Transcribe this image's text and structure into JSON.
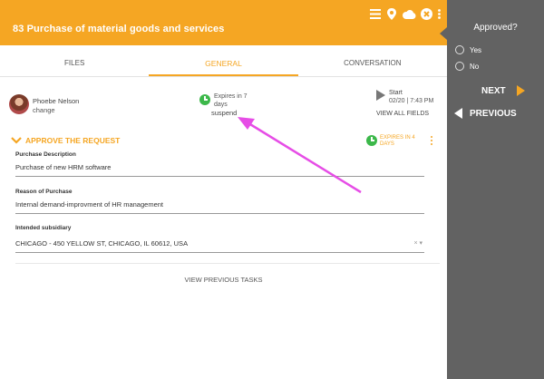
{
  "header": {
    "title": "83 Purchase of material goods and services",
    "icons": [
      "menu-icon",
      "location-icon",
      "cloud-icon",
      "close-icon",
      "more-icon"
    ]
  },
  "tabs": [
    {
      "label": "FILES"
    },
    {
      "label": "GENERAL",
      "active": true
    },
    {
      "label": "CONVERSATION"
    }
  ],
  "user": {
    "name": "Phoebe Nelson",
    "action": "change"
  },
  "expiry": {
    "text": "Expires in 7 days",
    "action": "suspend"
  },
  "start": {
    "label": "Start",
    "date": "02/20 | 7:43 PM"
  },
  "view_all_fields": "VIEW ALL FIELDS",
  "task": {
    "title": "APPROVE THE REQUEST",
    "expires": "EXPIRES IN 4 DAYS"
  },
  "fields": [
    {
      "label": "Purchase Description",
      "value": "Purchase of new HRM software"
    },
    {
      "label": "Reason of Purchase",
      "value": "Internal demand-improvment of HR management"
    },
    {
      "label": "Intended subsidiary",
      "value": "CHICAGO - 450 YELLOW ST, CHICAGO, IL 60612, USA",
      "control": "× ▾"
    }
  ],
  "view_previous": "VIEW PREVIOUS TASKS",
  "panel": {
    "question": "Approved?",
    "options": [
      {
        "label": "Yes"
      },
      {
        "label": "No"
      }
    ],
    "next_label": "NEXT",
    "previous_label": "PREVIOUS"
  },
  "colors": {
    "accent": "#f5a623",
    "panel": "#626262",
    "annotation_arrow": "#e64de6",
    "status_green": "#3cb84a"
  }
}
